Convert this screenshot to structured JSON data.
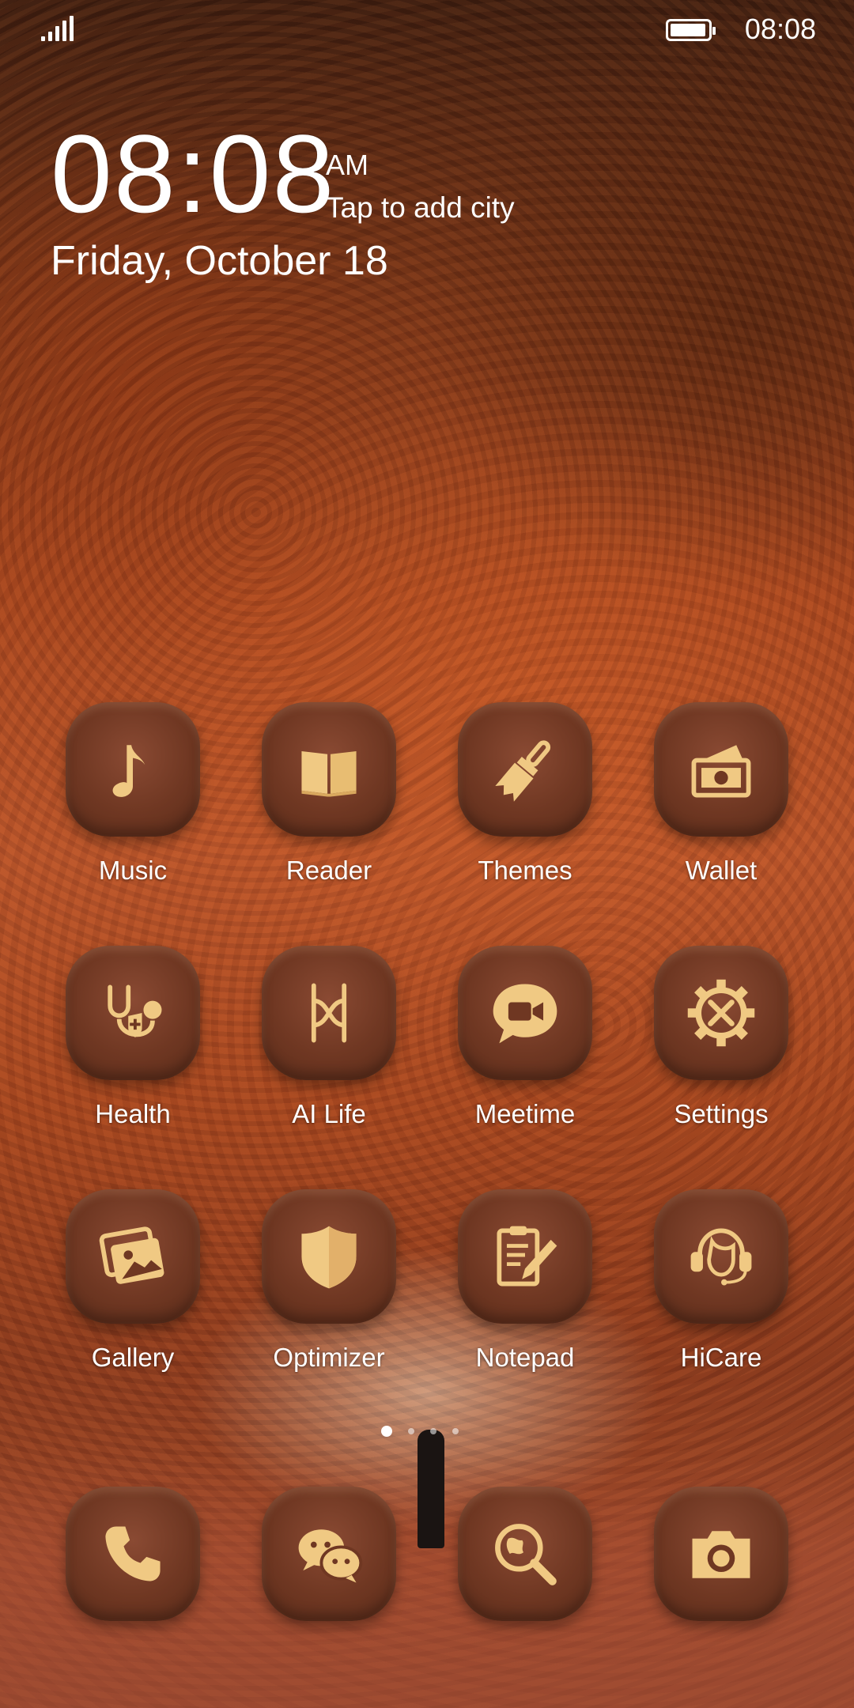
{
  "status_bar": {
    "time": "08:08",
    "battery_level": 0.95
  },
  "clock_widget": {
    "time": "08:08",
    "ampm": "AM",
    "city_prompt": "Tap to add city",
    "date": "Friday, October 18"
  },
  "apps": [
    {
      "label": "Music",
      "icon": "music-note-icon"
    },
    {
      "label": "Reader",
      "icon": "book-icon"
    },
    {
      "label": "Themes",
      "icon": "paintbrush-icon"
    },
    {
      "label": "Wallet",
      "icon": "wallet-icon"
    },
    {
      "label": "Health",
      "icon": "stethoscope-icon"
    },
    {
      "label": "AI Life",
      "icon": "ai-life-icon"
    },
    {
      "label": "Meetime",
      "icon": "video-chat-icon"
    },
    {
      "label": "Settings",
      "icon": "gear-tools-icon"
    },
    {
      "label": "Gallery",
      "icon": "photos-icon"
    },
    {
      "label": "Optimizer",
      "icon": "shield-icon"
    },
    {
      "label": "Notepad",
      "icon": "clipboard-pencil-icon"
    },
    {
      "label": "HiCare",
      "icon": "headset-icon"
    }
  ],
  "dock": [
    {
      "name": "phone",
      "icon": "phone-icon"
    },
    {
      "name": "messaging",
      "icon": "chat-bubbles-icon"
    },
    {
      "name": "browser",
      "icon": "globe-search-icon"
    },
    {
      "name": "camera",
      "icon": "camera-icon"
    }
  ],
  "page_indicator": {
    "pages": 4,
    "current": 1
  },
  "colors": {
    "icon_bg": "#6f3722",
    "icon_glyph": "#f0c983",
    "text": "#ffffff"
  }
}
